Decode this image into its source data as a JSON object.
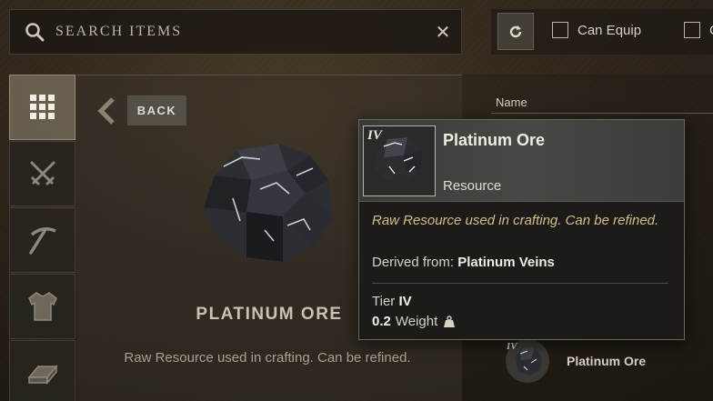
{
  "search": {
    "placeholder": "SEARCH ITEMS"
  },
  "filters": {
    "can_equip_label": "Can Equip",
    "second_label": "C"
  },
  "back_label": "BACK",
  "item_detail": {
    "name": "PLATINUM ORE",
    "description": "Raw Resource used in crafting. Can be refined."
  },
  "list": {
    "column_header": "Name",
    "row_name": "Platinum Ore"
  },
  "tooltip": {
    "tier_badge": "IV",
    "name": "Platinum Ore",
    "type": "Resource",
    "description": "Raw Resource used in crafting. Can be refined.",
    "derived_prefix": "Derived from:",
    "derived_source": "Platinum Veins",
    "tier_prefix": "Tier",
    "tier_value": "IV",
    "weight_value": "0.2",
    "weight_label": "Weight"
  },
  "categories": [
    "grid-icon",
    "swords-icon",
    "pickaxe-icon",
    "armor-icon",
    "ingot-icon"
  ],
  "colors": {
    "accent_text": "#d4bf85",
    "tooltip_bg": "#1c1b19"
  }
}
